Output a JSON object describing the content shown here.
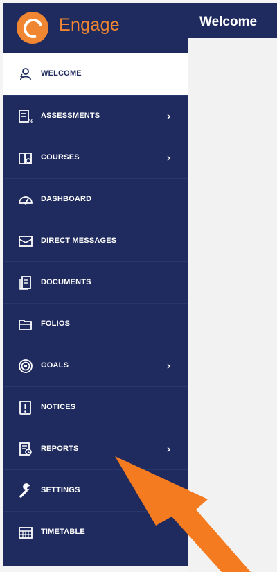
{
  "brand": {
    "name": "Engage",
    "accent_color": "#f08532",
    "sidebar_color": "#1f2b5e"
  },
  "header": {
    "title": "Welcome"
  },
  "sidebar": {
    "items": [
      {
        "label": "WELCOME",
        "icon": "welcome-icon",
        "has_submenu": false,
        "active": true
      },
      {
        "label": "ASSESSMENTS",
        "icon": "assessments-icon",
        "has_submenu": true,
        "active": false
      },
      {
        "label": "COURSES",
        "icon": "book-icon",
        "has_submenu": true,
        "active": false
      },
      {
        "label": "DASHBOARD",
        "icon": "dashboard-gauge-icon",
        "has_submenu": false,
        "active": false
      },
      {
        "label": "DIRECT MESSAGES",
        "icon": "message-icon",
        "has_submenu": false,
        "active": false
      },
      {
        "label": "DOCUMENTS",
        "icon": "documents-icon",
        "has_submenu": false,
        "active": false
      },
      {
        "label": "FOLIOS",
        "icon": "folder-icon",
        "has_submenu": false,
        "active": false
      },
      {
        "label": "GOALS",
        "icon": "target-icon",
        "has_submenu": true,
        "active": false
      },
      {
        "label": "NOTICES",
        "icon": "notice-icon",
        "has_submenu": false,
        "active": false
      },
      {
        "label": "REPORTS",
        "icon": "reports-icon",
        "has_submenu": true,
        "active": false
      },
      {
        "label": "SETTINGS",
        "icon": "wrench-icon",
        "has_submenu": false,
        "active": false
      },
      {
        "label": "TIMETABLE",
        "icon": "calendar-grid-icon",
        "has_submenu": false,
        "active": false
      }
    ],
    "chevron_glyph": "›"
  }
}
